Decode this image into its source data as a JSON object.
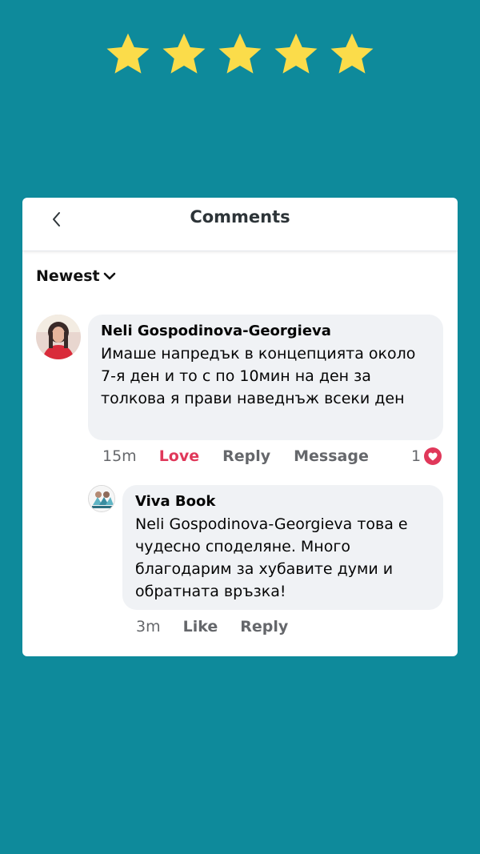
{
  "rating": {
    "stars": 5,
    "star_color": "#fbdc4a"
  },
  "header": {
    "title": "Comments",
    "back_icon": "chevron-left-icon"
  },
  "sort": {
    "label": "Newest",
    "icon": "chevron-down-icon"
  },
  "comments": [
    {
      "author": "Neli Gospodinova-Georgieva",
      "text": "Имаше  напредък в концепцията около  7-я ден и то  с по 10мин на ден за толкова я прави наведнъж всеки ден",
      "time": "15m",
      "actions": {
        "love": "Love",
        "reply": "Reply",
        "message": "Message"
      },
      "reaction_count": "1",
      "reaction_icon": "heart-icon",
      "love_color": "#e0385a"
    },
    {
      "author": "Viva Book",
      "text": "Neli Gospodinova-Georgieva това е чудесно споделяне. Много благодарим за хубавите думи и обратната връзка!",
      "time": "3m",
      "actions": {
        "like": "Like",
        "reply": "Reply"
      }
    }
  ],
  "colors": {
    "background": "#0e8a9b",
    "card": "#ffffff",
    "bubble": "#f0f2f5"
  }
}
